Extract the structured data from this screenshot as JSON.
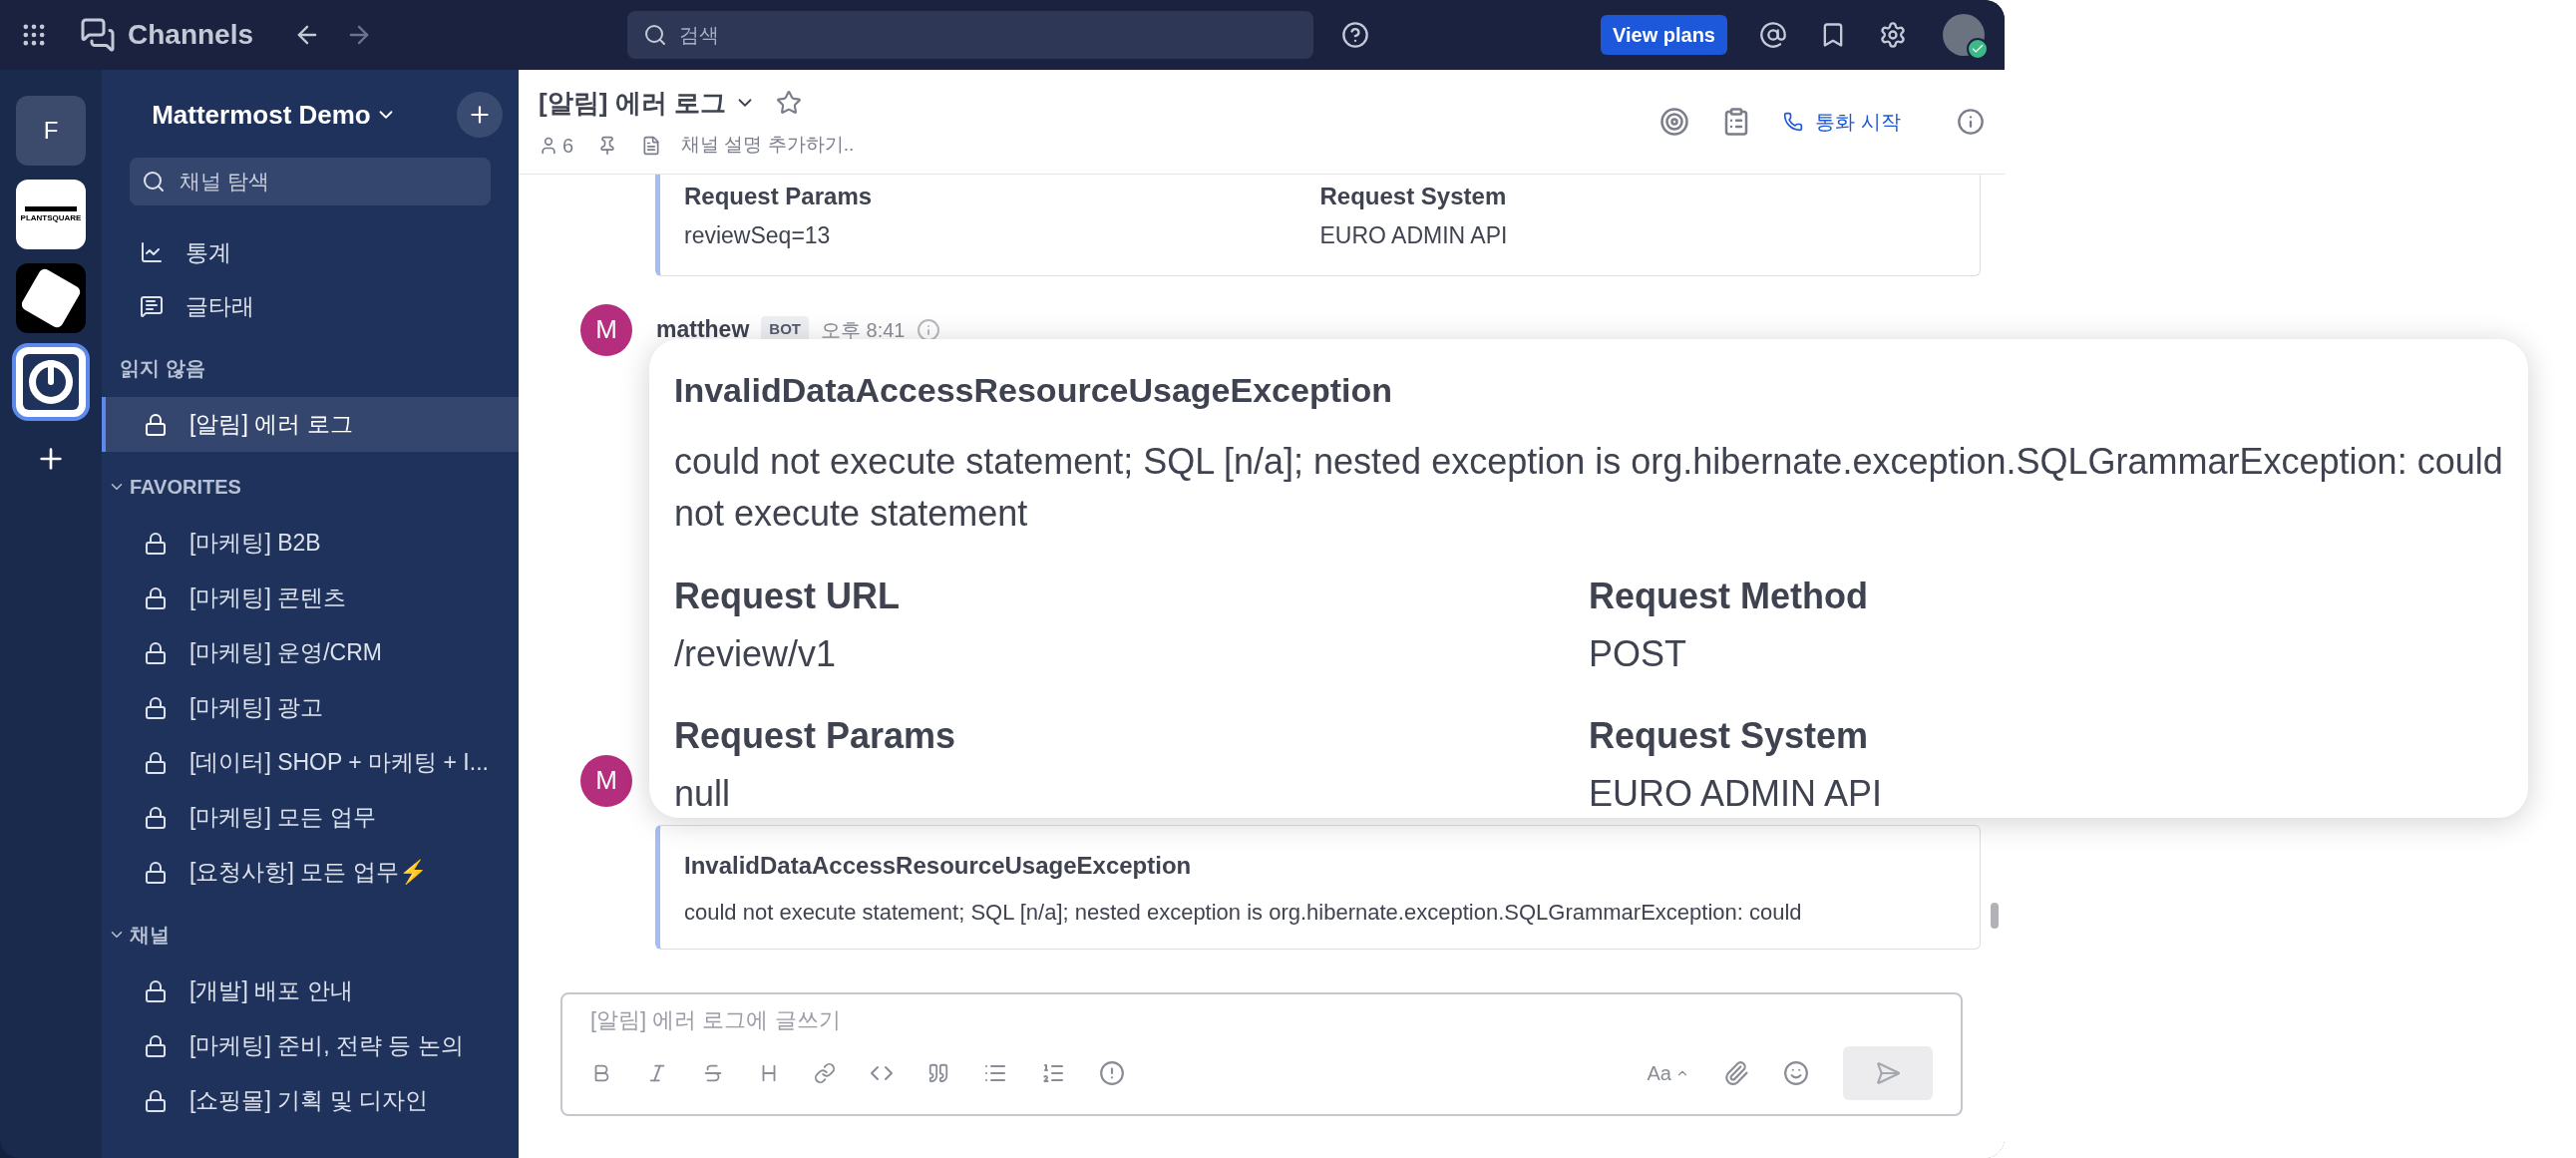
{
  "top_bar": {
    "title": "Channels",
    "search": {
      "placeholder": "검색"
    },
    "view_plans": "View plans"
  },
  "teams": [
    {
      "kind": "letter",
      "label": "F",
      "selected": false
    },
    {
      "kind": "wordmark",
      "label": "PLANTSQUARE",
      "selected": false
    },
    {
      "kind": "diamond",
      "selected": false
    },
    {
      "kind": "mattermost",
      "selected": true
    }
  ],
  "sidebar": {
    "team_name": "Mattermost Demo",
    "search": {
      "placeholder": "채널 탐색"
    },
    "nav": [
      {
        "kind": "insights",
        "label": "통계"
      },
      {
        "kind": "threads",
        "label": "글타래"
      }
    ],
    "sections": [
      {
        "title": "읽지 않음",
        "channels": [
          {
            "name": "[알림] 에러 로그",
            "selected": true
          }
        ]
      },
      {
        "title": "FAVORITES",
        "expanded": true,
        "channels": [
          {
            "name": "[마케팅] B2B",
            "selected": false
          },
          {
            "name": "[마케팅] 콘텐츠",
            "selected": false
          },
          {
            "name": "[마케팅] 운영/CRM",
            "selected": false
          },
          {
            "name": "[마케팅] 광고",
            "selected": false
          },
          {
            "name": "[데이터] SHOP + 마케팅 + I...",
            "selected": false
          },
          {
            "name": "[마케팅] 모든 업무",
            "selected": false
          },
          {
            "name": "[요청사항] 모든 업무⚡",
            "selected": false
          }
        ]
      },
      {
        "title": "채널",
        "expanded": true,
        "channels": [
          {
            "name": "[개발] 배포 안내",
            "selected": false
          },
          {
            "name": "[마케팅] 준비, 전략 등 논의",
            "selected": false
          },
          {
            "name": "[쇼핑몰] 기획 및 디자인",
            "selected": false
          }
        ]
      }
    ]
  },
  "channel_header": {
    "title": "[알림] 에러 로그",
    "members": "6",
    "description_placeholder": "채널 설명 추가하기..",
    "call": "통화 시작"
  },
  "messages": {
    "first_attachment": {
      "fields": [
        {
          "title": "Request Params",
          "value": "reviewSeq=13"
        },
        {
          "title": "Request System",
          "value": "EURO ADMIN API"
        }
      ]
    },
    "post": {
      "avatar": "M",
      "author": "matthew",
      "badge": "BOT",
      "time": "오후 8:41"
    },
    "second_avatar": "M",
    "second_attachment": {
      "title": "InvalidDataAccessResourceUsageException",
      "text": "could not execute statement; SQL [n/a]; nested exception is org.hibernate.exception.SQLGrammarException: could"
    }
  },
  "popup": {
    "title": "InvalidDataAccessResourceUsageException",
    "text": "could not execute statement; SQL [n/a]; nested exception is org.hibernate.exception.SQLGrammarException: could not execute statement",
    "fields": [
      {
        "title": "Request URL",
        "value": "/review/v1"
      },
      {
        "title": "Request Method",
        "value": "POST"
      },
      {
        "title": "Request Params",
        "value": "null"
      },
      {
        "title": "Request System",
        "value": "EURO ADMIN API"
      }
    ]
  },
  "composer": {
    "placeholder": "[알림] 에러 로그에 글쓰기",
    "format_label": "Aa"
  }
}
